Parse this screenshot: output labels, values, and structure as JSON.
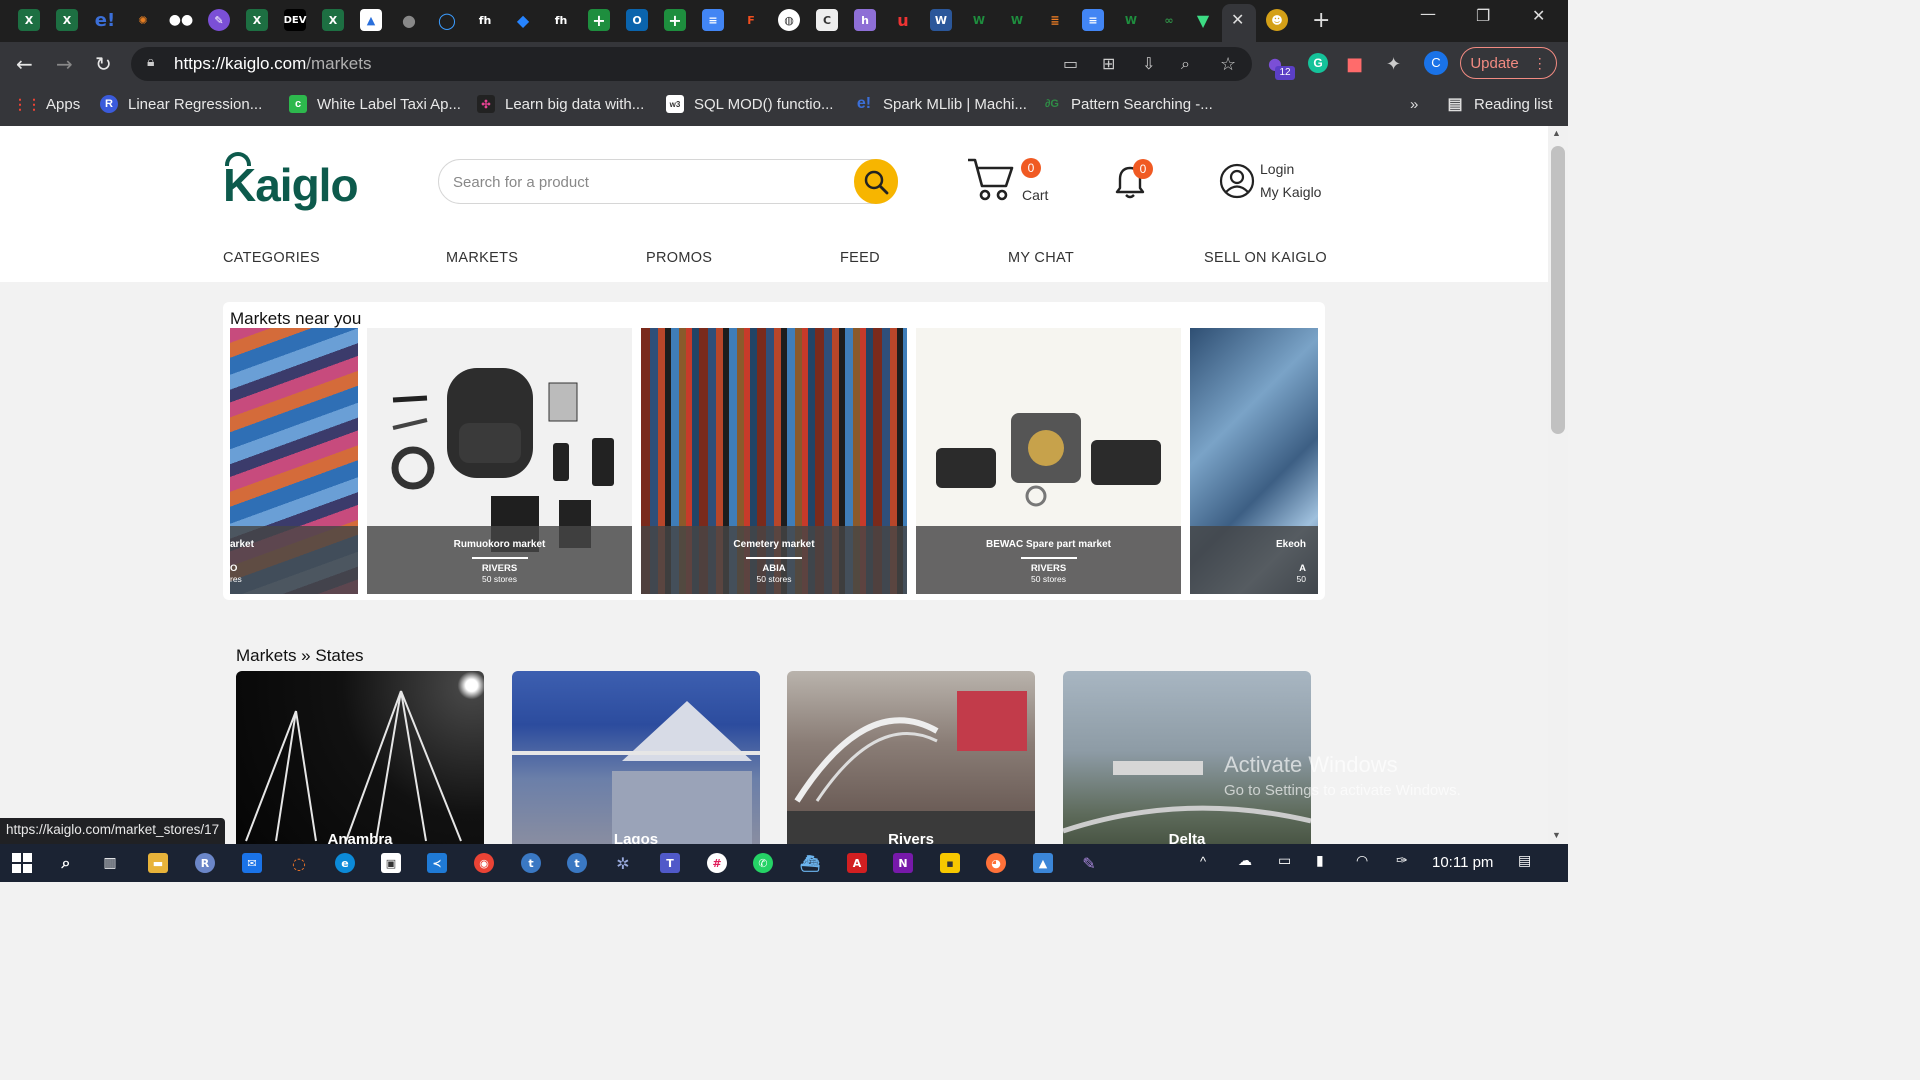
{
  "browser": {
    "url_domain": "https://kaiglo.com",
    "url_path": "/markets",
    "update_label": "Update",
    "extension_badge": "12",
    "profile_initial": "C",
    "bookmarks": [
      {
        "label": "Apps",
        "color": "#ea4335"
      },
      {
        "label": "Linear Regression...",
        "color": "#3b5bdb"
      },
      {
        "label": "White Label Taxi Ap...",
        "color": "#2db84d"
      },
      {
        "label": "Learn big data with...",
        "color": "#e84393"
      },
      {
        "label": "SQL MOD() functio...",
        "color": "#ffffff"
      },
      {
        "label": "Spark MLlib | Machi...",
        "color": "#3b6fd8"
      },
      {
        "label": "Pattern Searching -...",
        "color": "#2f8d46"
      }
    ],
    "reading_list_label": "Reading list",
    "status_url": "https://kaiglo.com/market_stores/17"
  },
  "site": {
    "logo_text": "Kaiglo",
    "search_placeholder": "Search for a product",
    "cart_label": "Cart",
    "cart_count": "0",
    "notification_count": "0",
    "login_label": "Login",
    "account_label": "My Kaiglo",
    "nav": [
      "CATEGORIES",
      "MARKETS",
      "PROMOS",
      "FEED",
      "MY CHAT",
      "SELL ON KAIGLO"
    ]
  },
  "near": {
    "title": "Markets near you",
    "markets": [
      {
        "name": "arket",
        "state": "O",
        "count": "res"
      },
      {
        "name": "Rumuokoro market",
        "state": "RIVERS",
        "count": "50 stores"
      },
      {
        "name": "Cemetery market",
        "state": "ABIA",
        "count": "50 stores"
      },
      {
        "name": "BEWAC Spare part market",
        "state": "RIVERS",
        "count": "50 stores"
      },
      {
        "name": "Ekeoh",
        "state": "A",
        "count": "50"
      }
    ]
  },
  "states": {
    "title": "Markets » States",
    "items": [
      "Anambra",
      "Lagos",
      "Rivers",
      "Delta"
    ]
  },
  "watermark": {
    "line1": "Activate Windows",
    "line2": "Go to Settings to activate Windows."
  },
  "taskbar": {
    "time": "10:11 pm"
  }
}
